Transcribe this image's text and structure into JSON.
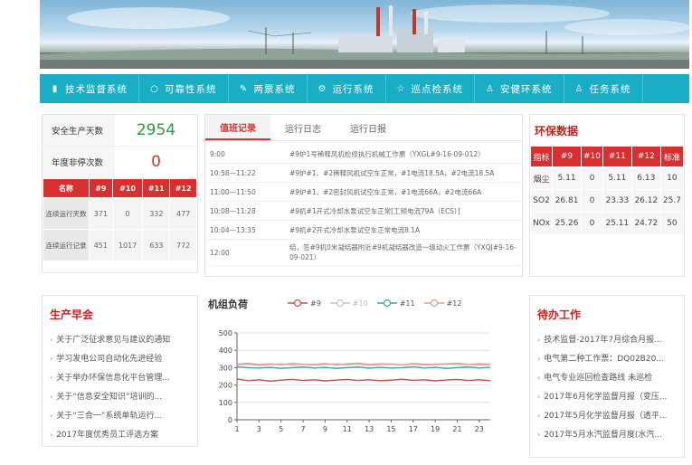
{
  "nav": [
    {
      "icon": "bar-chart-icon",
      "label": "技术监督系统"
    },
    {
      "icon": "circle-icon",
      "label": "可靠性系统"
    },
    {
      "icon": "wrench-icon",
      "label": "两票系统"
    },
    {
      "icon": "gears-icon",
      "label": "运行系统"
    },
    {
      "icon": "star-icon",
      "label": "巡点检系统"
    },
    {
      "icon": "worker-icon",
      "label": "安健环系统"
    },
    {
      "icon": "worker-icon",
      "label": "任务系统"
    }
  ],
  "safety": {
    "days_label": "安全生产天数",
    "days_value": "2954",
    "stops_label": "年度非停次数",
    "stops_value": "0",
    "headers": [
      "名称",
      "#9",
      "#10",
      "#11",
      "#12"
    ],
    "rows": [
      {
        "label": "连续运行天数",
        "values": [
          "371",
          "0",
          "332",
          "477"
        ]
      },
      {
        "label": "连续运行记录",
        "values": [
          "451",
          "1017",
          "633",
          "772"
        ]
      }
    ]
  },
  "tabs": [
    "值班记录",
    "运行日志",
    "运行日报"
  ],
  "log": [
    {
      "time": "9:00",
      "text": "#9炉1号稀释风机检修执行机械工作票（YXGL#9-16-09-012）"
    },
    {
      "time": "10:58—11:22",
      "text": "#9炉#1、#2稀释风机试空车正常，#1电流18.5A，#2电流18.5A"
    },
    {
      "time": "11:00—11:50",
      "text": "#9炉#1、#2密封风机试空车正常，#1电流66A，#2电流66A"
    },
    {
      "time": "10:08—11:28",
      "text": "#9机#1开式冷却水泵试空车正常[工频电流79A（ECS）]"
    },
    {
      "time": "10:04—13:35",
      "text": "#9机#2开式冷却水泵试空车正常电流8.1A"
    },
    {
      "time": "12:00",
      "text": "结，签#9机0米凝结器附近#9机凝结器改造一级动火工作票（YXQJ#9-16-09-021）"
    }
  ],
  "env": {
    "title": "环保数据",
    "headers": [
      "指标",
      "#9",
      "#10",
      "#11",
      "#12",
      "标准"
    ],
    "rows": [
      [
        "烟尘",
        "5.11",
        "0",
        "5.11",
        "6.13",
        "10"
      ],
      [
        "SO2",
        "26.81",
        "0",
        "23.33",
        "26.12",
        "25.7"
      ],
      [
        "NOx",
        "25.26",
        "0",
        "25.11",
        "24.72",
        "50"
      ]
    ]
  },
  "meeting": {
    "title": "生产早会",
    "items": [
      "关于广泛征求意见与建议的通知",
      "学习发电公司自动化先进经验",
      "关于举办环保信息化平台管理...",
      "关于“信息安全知识”培训的...",
      "关于“三合一”系统单轨运行...",
      "2017年度优秀员工评选方案"
    ]
  },
  "todo": {
    "title": "待办工作",
    "items": [
      "技术监督-2017年7月综合月报...",
      "电气第二种工作票：DQ02B20...",
      "电气专业巡回检查路线 未巡检",
      "2017年6月化学监督月报（变压...",
      "2017年5月化学监督月报（透平...",
      "2017年5月水汽监督月度(水汽..."
    ]
  },
  "chart_data": {
    "title": "机组负荷",
    "type": "line",
    "x": [
      1,
      2,
      3,
      4,
      5,
      6,
      7,
      8,
      9,
      10,
      11,
      12,
      13,
      14,
      15,
      16,
      17,
      18,
      19,
      20,
      21,
      22,
      23,
      24
    ],
    "xticks": [
      1,
      3,
      5,
      7,
      9,
      11,
      13,
      15,
      17,
      19,
      21,
      23
    ],
    "ylim": [
      0,
      500
    ],
    "yticks": [
      0,
      100,
      200,
      300,
      400,
      500
    ],
    "grid": true,
    "legend": "top",
    "series": [
      {
        "name": "#9",
        "color": "#c0504d",
        "values": [
          235,
          225,
          230,
          222,
          228,
          232,
          226,
          230,
          224,
          228,
          232,
          226,
          230,
          225,
          228,
          233,
          227,
          230,
          224,
          229,
          232,
          226,
          230,
          225
        ]
      },
      {
        "name": "#10",
        "color": "#b8c8c8",
        "values": [
          315,
          320,
          312,
          318,
          322,
          316,
          320,
          314,
          318,
          322,
          316,
          320,
          313,
          318,
          322,
          316,
          320,
          314,
          319,
          322,
          316,
          320,
          314,
          318
        ]
      },
      {
        "name": "#11",
        "color": "#4a9aa5",
        "values": [
          305,
          300,
          298,
          302,
          296,
          300,
          304,
          298,
          302,
          296,
          300,
          304,
          297,
          302,
          298,
          300,
          305,
          298,
          302,
          296,
          300,
          304,
          298,
          302
        ]
      },
      {
        "name": "#12",
        "color": "#e39a86",
        "values": [
          320,
          325,
          318,
          322,
          316,
          324,
          320,
          318,
          324,
          316,
          322,
          326,
          318,
          322,
          320,
          316,
          324,
          320,
          318,
          322,
          326,
          318,
          322,
          320
        ]
      }
    ]
  }
}
